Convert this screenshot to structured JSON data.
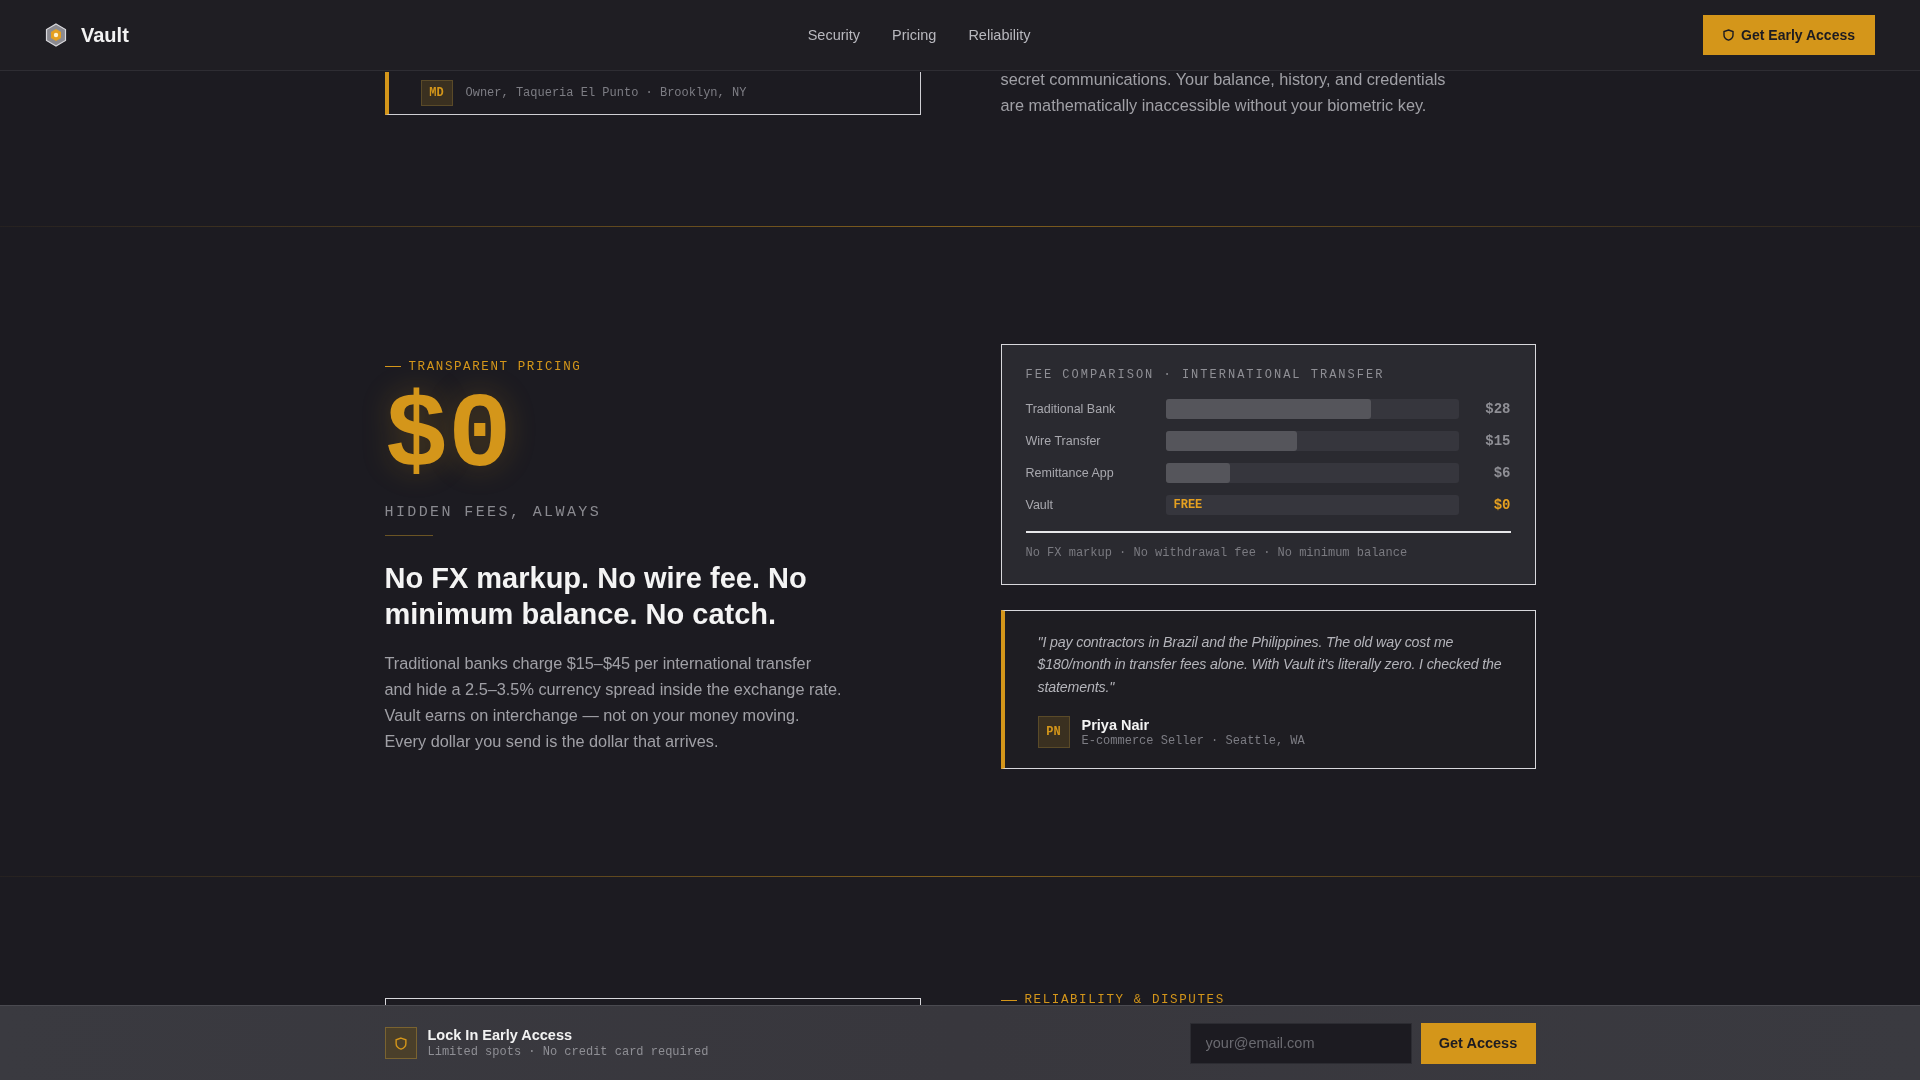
{
  "header": {
    "logo": "Vault",
    "nav": [
      "Security",
      "Pricing",
      "Reliability"
    ],
    "cta": "Get Early Access"
  },
  "intro": {
    "testimonial": {
      "avatar": "MD",
      "role": "Owner, Taqueria El Punto · Brooklyn, NY"
    },
    "paragraph": "secret communications. Your balance, history, and credentials are mathematically inaccessible without your biometric key."
  },
  "pricing": {
    "eyebrow": "TRANSPARENT PRICING",
    "big_number": "$0",
    "subtitle": "HIDDEN FEES, ALWAYS",
    "heading": "No FX markup. No wire fee. No minimum balance. No catch.",
    "paragraph": "Traditional banks charge $15–$45 per international transfer and hide a 2.5–3.5% currency spread inside the exchange rate. Vault earns on interchange — not on your money moving. Every dollar you send is the dollar that arrives.",
    "fee_card": {
      "title": "FEE COMPARISON · INTERNATIONAL TRANSFER",
      "rows": [
        {
          "label": "Traditional Bank",
          "level": 0.7,
          "price": "$28",
          "highlight": false
        },
        {
          "label": "Wire Transfer",
          "level": 0.45,
          "price": "$15",
          "highlight": false
        },
        {
          "label": "Remittance App",
          "level": 0.22,
          "price": "$6",
          "highlight": false
        },
        {
          "label": "Vault",
          "price": "$0",
          "highlight": true,
          "bar_label": "FREE"
        }
      ],
      "footnote": "No FX markup · No withdrawal fee · No minimum balance"
    },
    "testimonial": {
      "quote": "\"I pay contractors in Brazil and the Philippines. The old way cost me $180/month in transfer fees alone. With Vault it's literally zero. I checked the statements.\"",
      "avatar": "PN",
      "name": "Priya Nair",
      "role": "E-commerce Seller · Seattle, WA"
    }
  },
  "reliability": {
    "eyebrow": "RELIABILITY & DISPUTES"
  },
  "sticky_bar": {
    "title": "Lock In Early Access",
    "subtitle": "Limited spots · No credit card required",
    "email_placeholder": "your@email.com",
    "button": "Get Access"
  }
}
